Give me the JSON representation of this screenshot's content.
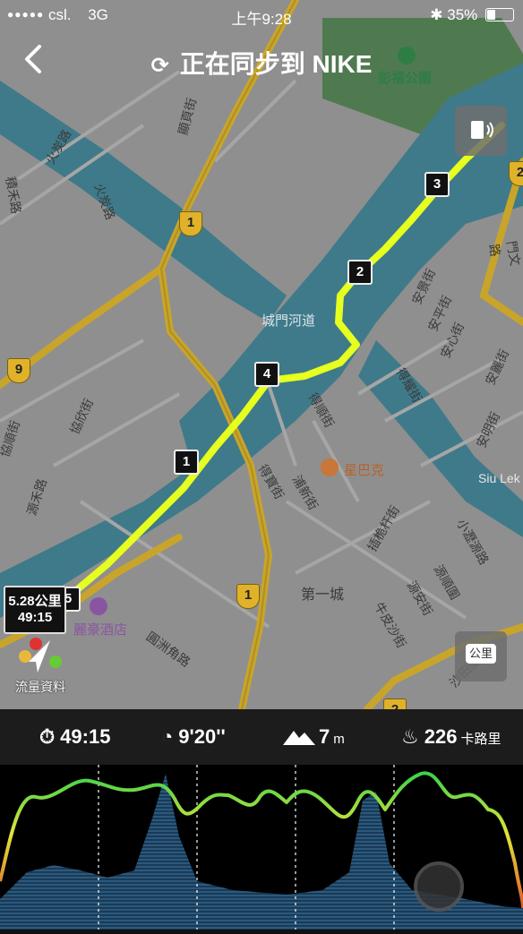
{
  "status": {
    "carrier": "csl.",
    "network": "3G",
    "time": "上午9:28",
    "battery": "35%",
    "battery_level": 0.35
  },
  "nav": {
    "title": "正在同步到 NIKE",
    "back_icon": "chevron-left-icon",
    "sync_icon": "sync-icon"
  },
  "map": {
    "labels": {
      "park": "彭福公園",
      "river": "城門河道",
      "starbucks": "星巴克",
      "hotel": "麗豪酒店",
      "estate": "第一城",
      "siulek": "Siu Lek",
      "st_huohtan": "火炭路",
      "st_huohtan2": "火炭路",
      "st_zhengwei": "顯頁街",
      "st_xiemu": "積禾路",
      "st_yuanhe": "源禾路",
      "st_xieli": "協欣街",
      "st_xieli2": "協順街",
      "st_anjing": "安景街",
      "st_anping": "安平街",
      "st_anxin": "安心街",
      "st_anli": "安麗街",
      "st_anming": "安明街",
      "st_deju": "得耀街",
      "st_deshun": "得順街",
      "st_debao": "得寶街",
      "st_chapiao": "插桅杆街",
      "st_xiaoli": "小瀝源路",
      "st_yuanshun": "源順圍",
      "st_yuanan": "源安街",
      "st_niupi": "牛皮沙街",
      "st_yuanzhou": "圓洲角路",
      "st_shatian": "沙田圍路",
      "st_menjia": "門文路",
      "st_puxu": "浦新街"
    },
    "road_badges": [
      "1",
      "1",
      "9",
      "1",
      "2",
      "2"
    ],
    "km_markers": [
      "1",
      "2",
      "3",
      "4",
      "5"
    ],
    "distance": "5.28公里",
    "distance_time": "49:15",
    "traffic_label": "流量資料",
    "unit_button": "公里",
    "speaker_icon": "speaker-icon"
  },
  "stats": {
    "duration": "49:15",
    "pace": "9'20''",
    "elevation": "7",
    "elevation_unit": "m",
    "calories": "226",
    "calories_unit": "卡路里",
    "duration_icon": "stopwatch-icon",
    "pace_icon": "gauge-icon",
    "elevation_icon": "mountain-icon",
    "calories_icon": "flame-icon"
  },
  "colors": {
    "route": "#e6ff1e",
    "map_bg": "#8f8f8f",
    "water": "#3f7a8a",
    "road": "#c8a52a",
    "park": "#4f7a4f",
    "pace_fast": "#3cd24a",
    "pace_mid": "#e2e63a",
    "pace_slow": "#e0572a",
    "elevation_fill": "#2d5f83"
  }
}
